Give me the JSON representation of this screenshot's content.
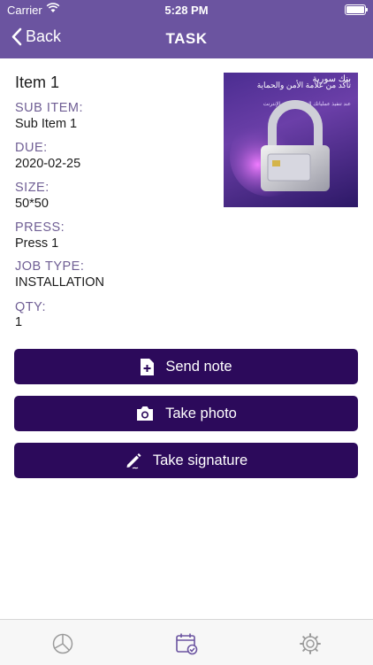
{
  "status_bar": {
    "carrier": "Carrier",
    "time": "5:28 PM"
  },
  "nav": {
    "back_label": "Back",
    "title": "TASK"
  },
  "task": {
    "name": "Item 1",
    "fields": [
      {
        "label": "SUB ITEM:",
        "value": "Sub Item 1"
      },
      {
        "label": "DUE:",
        "value": "2020-02-25"
      },
      {
        "label": "SIZE:",
        "value": "50*50"
      },
      {
        "label": "PRESS:",
        "value": "Press 1"
      },
      {
        "label": "JOB TYPE:",
        "value": "INSTALLATION"
      },
      {
        "label": "QTY:",
        "value": "1"
      }
    ]
  },
  "ad": {
    "headline": "تأكد من علامة الأمن والحماية",
    "subline": "عند تنفيذ عملياتك المصرفية عبر الإنترنت",
    "brand": "بنك سورية"
  },
  "actions": {
    "send_note": "Send note",
    "take_photo": "Take photo",
    "take_signature": "Take signature"
  },
  "colors": {
    "header": "#6b54a0",
    "button": "#2c0a5b",
    "label": "#6f5e94",
    "active_tab": "#6b54a0"
  },
  "tabbar": {
    "items": [
      {
        "icon": "chart-icon",
        "active": false
      },
      {
        "icon": "calendar-check-icon",
        "active": true
      },
      {
        "icon": "gear-icon",
        "active": false
      }
    ]
  }
}
